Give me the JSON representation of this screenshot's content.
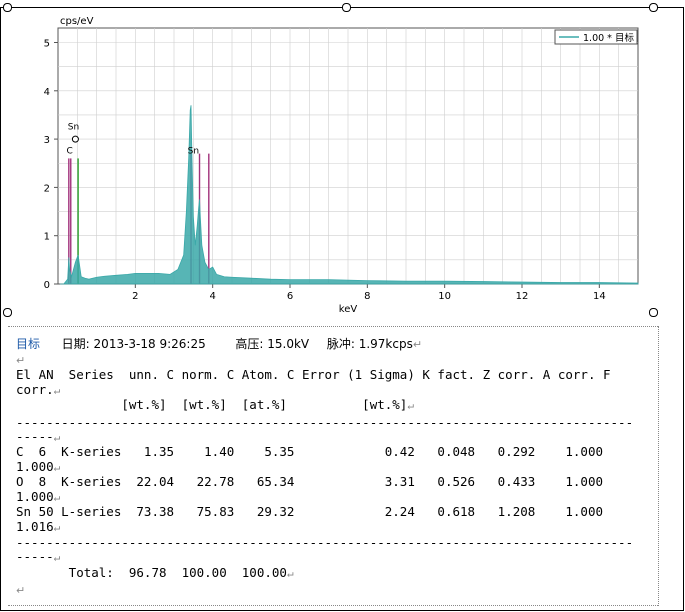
{
  "chart_data": {
    "type": "line",
    "ylabel": "cps/eV",
    "xlabel": "keV",
    "xlim": [
      0,
      15
    ],
    "ylim": [
      0,
      5.3
    ],
    "x_ticks": [
      2,
      4,
      6,
      8,
      10,
      12,
      14
    ],
    "y_ticks": [
      0,
      1,
      2,
      3,
      4,
      5
    ],
    "grid": true,
    "legend_position": "top-right",
    "series": [
      {
        "name": "1.00 * 目标",
        "color": "#3aa8a8",
        "x": [
          0.05,
          0.15,
          0.25,
          0.28,
          0.3,
          0.35,
          0.45,
          0.52,
          0.6,
          0.7,
          0.8,
          1.0,
          1.2,
          1.5,
          1.8,
          2.0,
          2.3,
          2.6,
          2.9,
          3.1,
          3.25,
          3.32,
          3.38,
          3.42,
          3.44,
          3.46,
          3.5,
          3.55,
          3.6,
          3.64,
          3.66,
          3.68,
          3.72,
          3.8,
          3.9,
          4.0,
          4.1,
          4.3,
          4.5,
          5.0,
          5.5,
          6.0,
          6.5,
          7.0,
          8.0,
          9.0,
          10.0,
          11.0,
          12.0,
          13.0,
          14.0,
          15.0
        ],
        "values": [
          0,
          0,
          0.1,
          0.55,
          0.3,
          0.15,
          0.45,
          0.6,
          0.15,
          0.12,
          0.1,
          0.14,
          0.16,
          0.18,
          0.2,
          0.22,
          0.22,
          0.22,
          0.2,
          0.3,
          0.6,
          1.5,
          2.6,
          3.6,
          3.7,
          2.8,
          1.4,
          0.8,
          1.2,
          1.6,
          1.75,
          1.4,
          0.8,
          0.45,
          0.3,
          0.35,
          0.2,
          0.15,
          0.14,
          0.12,
          0.1,
          0.09,
          0.09,
          0.09,
          0.07,
          0.06,
          0.06,
          0.05,
          0.04,
          0.03,
          0.03,
          0.02
        ]
      }
    ],
    "peak_markers": [
      {
        "label": "C",
        "x": 0.28,
        "color": "#a0307a"
      },
      {
        "label": "C",
        "x": 0.33,
        "color": "#a0307a"
      },
      {
        "label": "O",
        "x": 0.52,
        "color": "#2aa02a"
      },
      {
        "label": "Sn",
        "x": 3.44,
        "color": "#a0307a"
      },
      {
        "label": "Sn",
        "x": 3.66,
        "color": "#a0307a"
      },
      {
        "label": "Sn",
        "x": 3.9,
        "color": "#a0307a"
      }
    ],
    "annotations": [
      {
        "text": "Sn",
        "x": 0.4,
        "y": 3.2
      },
      {
        "text": "C",
        "x": 0.3,
        "y": 2.7
      },
      {
        "text": "Sn",
        "x": 3.5,
        "y": 2.7
      }
    ]
  },
  "info": {
    "label": "目标",
    "date_label": "日期:",
    "date_value": "2013-3-18 9:26:25",
    "hv_label": "高压:",
    "hv_value": "15.0kV",
    "pulse_label": "脉冲:",
    "pulse_value": "1.97kcps"
  },
  "table": {
    "header1": "El AN  Series  unn. C norm. C Atom. C Error (1 Sigma) K fact. Z corr. A corr. F",
    "header1b": "corr.",
    "header2": "              [wt.%]  [wt.%]  [at.%]          [wt.%]",
    "divider": "----------------------------------------------------------------------------------",
    "divider_tail": "-----",
    "rows": [
      {
        "line": "C  6  K-series   1.35    1.40    5.35            0.42   0.048   0.292    1.000",
        "tail": "1.000"
      },
      {
        "line": "O  8  K-series  22.04   22.78   65.34            3.31   0.526   0.433    1.000",
        "tail": "1.000"
      },
      {
        "line": "Sn 50 L-series  73.38   75.83   29.32            2.24   0.618   1.208    1.000",
        "tail": "1.016"
      }
    ],
    "total": "       Total:  96.78  100.00  100.00"
  },
  "return_mark": "↵",
  "colors": {
    "spectrum": "#3aa8a8",
    "marker_c": "#a0307a",
    "marker_o": "#2aa02a",
    "grid": "#cfcfcf",
    "info_blue": "#1e5aa8"
  }
}
